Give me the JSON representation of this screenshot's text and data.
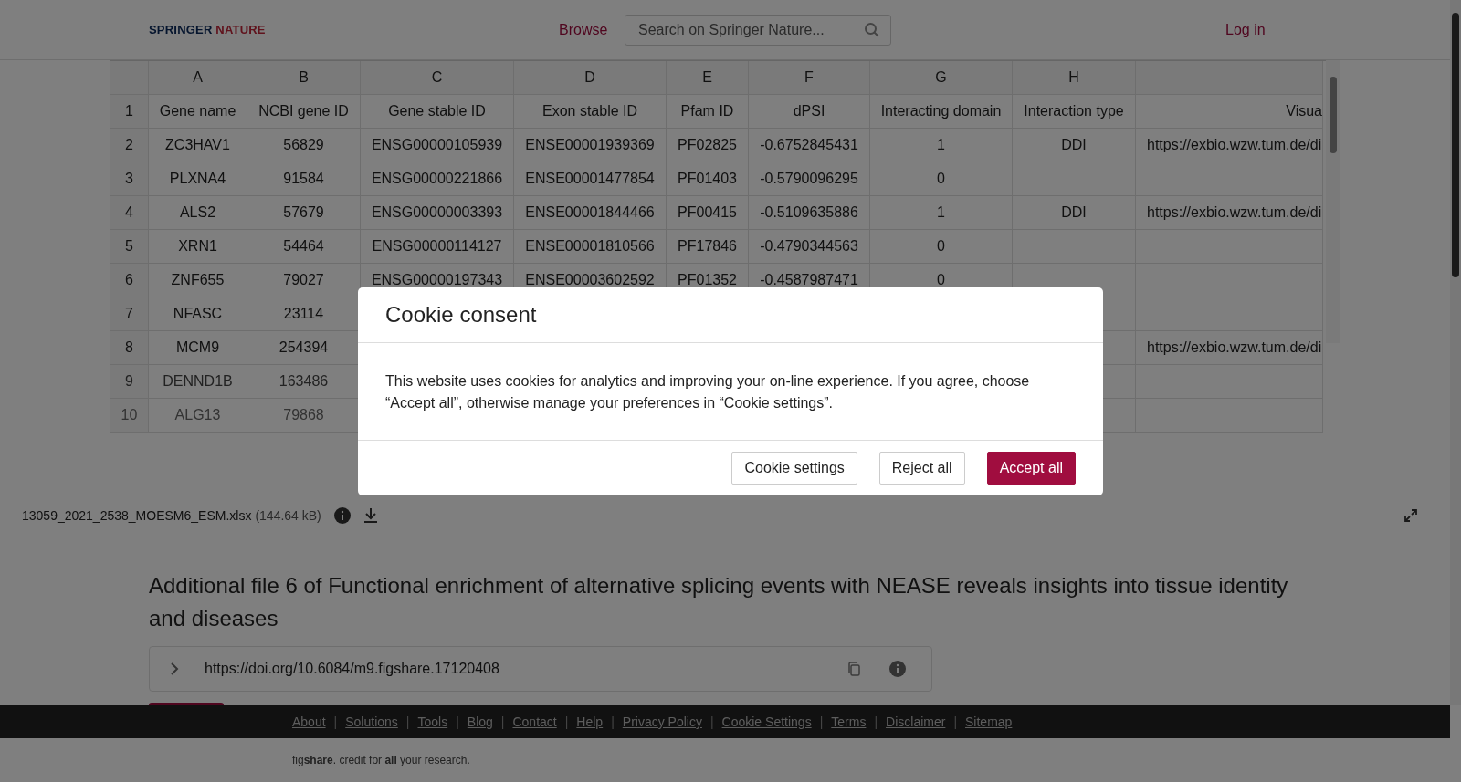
{
  "header": {
    "logo": {
      "first": "SPRINGER",
      "second": "NATURE"
    },
    "browse_link": "Browse",
    "search": {
      "placeholder": "Search on Springer Nature..."
    },
    "login_link": "Log in"
  },
  "spreadsheet": {
    "columns": [
      "A",
      "B",
      "C",
      "D",
      "E",
      "F",
      "G",
      "H",
      null
    ],
    "rows": [
      {
        "number": "1",
        "cells": [
          "Gene name",
          "NCBI gene ID",
          "Gene stable ID",
          "Exon stable ID",
          "Pfam ID",
          "dPSI",
          "Interacting domain",
          "Interaction type",
          "Visua"
        ]
      },
      {
        "number": "2",
        "cells": [
          "ZC3HAV1",
          "56829",
          "ENSG00000105939",
          "ENSE00001939369",
          "PF02825",
          "-0.6752845431",
          "1",
          "DDI",
          "https://exbio.wzw.tum.de/di"
        ]
      },
      {
        "number": "3",
        "cells": [
          "PLXNA4",
          "91584",
          "ENSG00000221866",
          "ENSE00001477854",
          "PF01403",
          "-0.5790096295",
          "0",
          null,
          null
        ]
      },
      {
        "number": "4",
        "cells": [
          "ALS2",
          "57679",
          "ENSG00000003393",
          "ENSE00001844466",
          "PF00415",
          "-0.5109635886",
          "1",
          "DDI",
          "https://exbio.wzw.tum.de/di"
        ]
      },
      {
        "number": "5",
        "cells": [
          "XRN1",
          "54464",
          "ENSG00000114127",
          "ENSE00001810566",
          "PF17846",
          "-0.4790344563",
          "0",
          null,
          null
        ]
      },
      {
        "number": "6",
        "cells": [
          "ZNF655",
          "79027",
          "ENSG00000197343",
          "ENSE00003602592",
          "PF01352",
          "-0.4587987471",
          "0",
          null,
          null
        ]
      },
      {
        "number": "7",
        "cells": [
          "NFASC",
          "23114",
          null,
          null,
          null,
          null,
          null,
          null,
          null
        ]
      },
      {
        "number": "8",
        "cells": [
          "MCM9",
          "254394",
          null,
          null,
          null,
          null,
          null,
          null,
          "https://exbio.wzw.tum.de/di"
        ]
      },
      {
        "number": "9",
        "cells": [
          "DENND1B",
          "163486",
          null,
          null,
          null,
          null,
          null,
          null,
          null
        ]
      },
      {
        "number": "10",
        "cells": [
          "ALG13",
          "79868",
          null,
          null,
          null,
          null,
          null,
          null,
          null
        ]
      }
    ]
  },
  "file_bar": {
    "filename": "13059_2021_2538_MOESM6_ESM.xlsx",
    "size": "(144.64 kB)"
  },
  "title": "Additional file 6 of Functional enrichment of alternative splicing events with NEASE reveals insights into tissue identity and diseases",
  "doi": "https://doi.org/10.6084/m9.figshare.17120408",
  "footer": {
    "separator": "|",
    "links": [
      "About",
      "Solutions",
      "Tools",
      "Blog",
      "Contact",
      "Help",
      "Privacy Policy",
      "Cookie Settings",
      "Terms",
      "Disclaimer",
      "Sitemap"
    ],
    "credit": "fig**share**. credit for **all** your research."
  },
  "cookie_dialog": {
    "title": "Cookie consent",
    "text": "This website uses cookies for analytics and improving your on-line experience. If you agree, choose “Accept all”, otherwise manage your preferences in “Cookie settings”.",
    "buttons": [
      {
        "label": "Cookie settings",
        "kind": "secondary"
      },
      {
        "label": "Reject all",
        "kind": "secondary"
      },
      {
        "label": "Accept all",
        "kind": "primary"
      }
    ]
  }
}
